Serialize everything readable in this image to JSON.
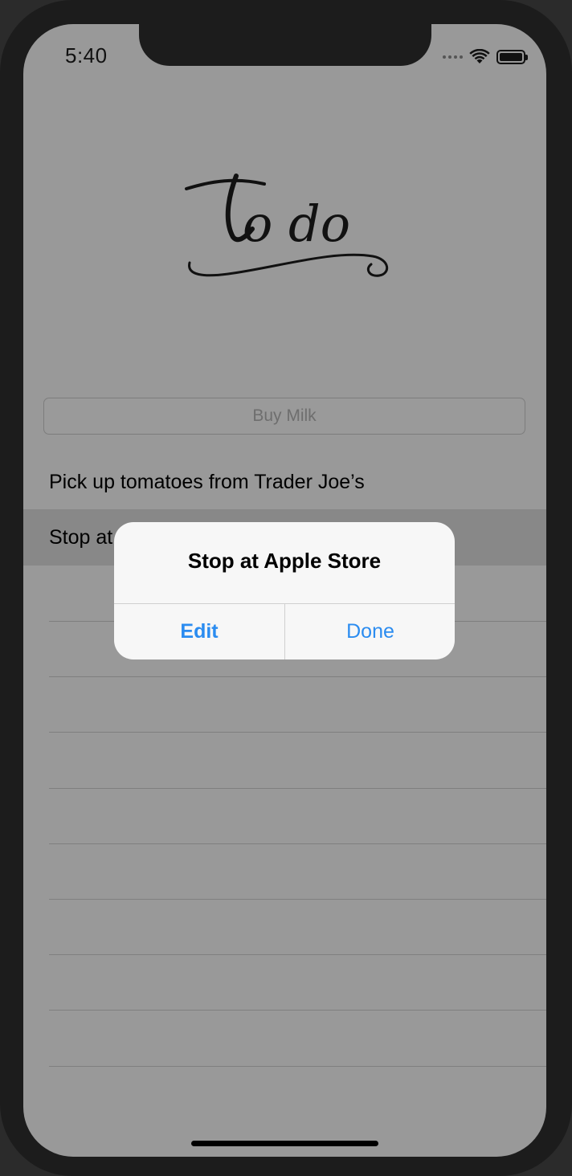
{
  "status_bar": {
    "time": "5:40",
    "wifi_icon": "wifi-icon",
    "battery_icon": "battery-icon",
    "signal_icon": "cellular-signal-icon"
  },
  "logo": {
    "text": "to do",
    "icon": "todo-script-logo"
  },
  "new_item_input": {
    "value": "",
    "placeholder": "Buy Milk"
  },
  "todo_items": [
    {
      "label": "Pick up tomatoes from Trader Joe’s",
      "selected": false
    },
    {
      "label": "Stop at Apple Store",
      "selected": true
    }
  ],
  "alert": {
    "title": "Stop at Apple Store",
    "buttons": [
      {
        "label": "Edit",
        "bold": true
      },
      {
        "label": "Done",
        "bold": false
      }
    ]
  },
  "colors": {
    "accent": "#2b8cf0",
    "dim_background": "#999999",
    "selected_row": "#888888"
  }
}
